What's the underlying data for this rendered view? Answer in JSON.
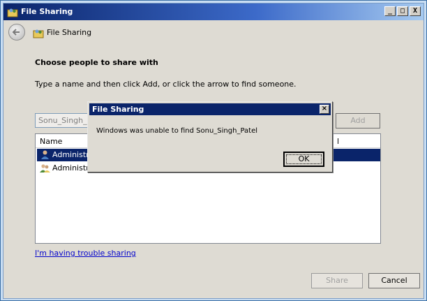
{
  "window": {
    "title": "File Sharing",
    "icon": "users-share-icon",
    "controls": {
      "minimize": "_",
      "maximize": "□",
      "close": "X"
    }
  },
  "nav": {
    "title": "File Sharing",
    "back_icon": "back-arrow-icon"
  },
  "main": {
    "heading": "Choose people to share with",
    "instructions": "Type a name and then click Add, or click the arrow to find someone.",
    "name_input_value": "Sonu_Singh_Pa",
    "add_button_label": "Add",
    "list": {
      "columns": [
        "Name",
        "l"
      ],
      "rows": [
        {
          "name": "Administrat",
          "selected": true,
          "icon": "user-icon"
        },
        {
          "name": "Administrat",
          "selected": false,
          "icon": "group-icon"
        }
      ]
    },
    "trouble_link": "I'm having trouble sharing"
  },
  "footer": {
    "share_label": "Share",
    "cancel_label": "Cancel"
  },
  "dialog": {
    "title": "File Sharing",
    "message": "Windows was unable to find Sonu_Singh_Patel",
    "ok_label": "OK",
    "close_glyph": "×"
  },
  "colors": {
    "titlebar": "#0a246a",
    "selection": "#0a246a",
    "link": "#0000cc",
    "background": "#dedbd3"
  }
}
